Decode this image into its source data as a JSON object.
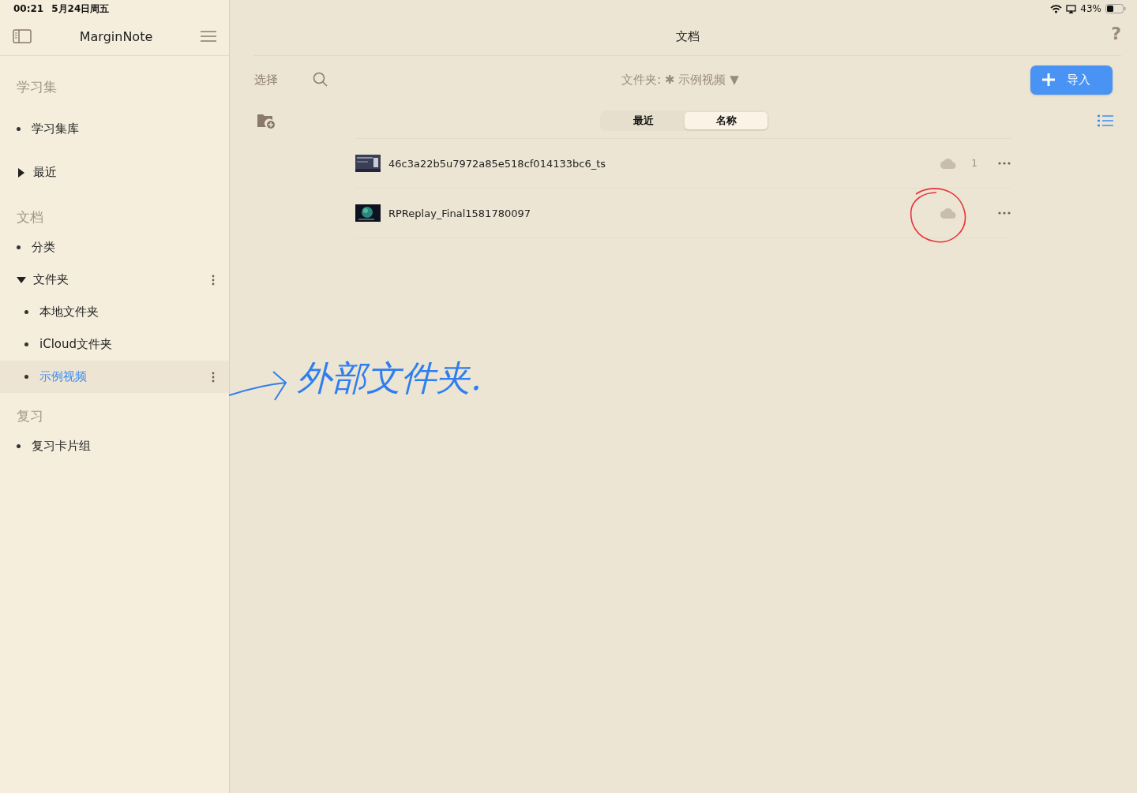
{
  "status_bar": {
    "time": "00:21",
    "date": "5月24日周五",
    "battery": "43%"
  },
  "sidebar": {
    "title": "MarginNote",
    "sections": [
      {
        "header": "学习集",
        "items": [
          {
            "label": "学习集库",
            "kind": "bullet",
            "selected": false
          },
          {
            "label": "最近",
            "kind": "toggle",
            "expanded": false,
            "selected": false
          }
        ]
      },
      {
        "header": "文档",
        "items": [
          {
            "label": "分类",
            "kind": "bullet",
            "selected": false
          },
          {
            "label": "文件夹",
            "kind": "toggle",
            "expanded": true,
            "menu": true,
            "selected": false,
            "children": [
              {
                "label": "本地文件夹",
                "kind": "bullet",
                "selected": false
              },
              {
                "label": "iCloud文件夹",
                "kind": "bullet",
                "selected": false
              },
              {
                "label": "示例视频",
                "kind": "bullet",
                "selected": true,
                "menu": true
              }
            ]
          }
        ]
      },
      {
        "header": "复习",
        "items": [
          {
            "label": "复习卡片组",
            "kind": "bullet",
            "selected": false
          }
        ]
      }
    ]
  },
  "main": {
    "title": "文档",
    "help": "?",
    "select": "选择",
    "folder_label": "文件夹:",
    "folder_mark": "✱",
    "folder_name": "示例视频",
    "folder_caret": "▼",
    "import_button": "导入",
    "sort_tabs": [
      {
        "label": "最近",
        "selected": false
      },
      {
        "label": "名称",
        "selected": true
      }
    ],
    "files": [
      {
        "name": "46c3a22b5u7972a85e518cf014133bc6_ts",
        "count": "1",
        "circled": false
      },
      {
        "name": "RPReplay_Final1581780097",
        "circled": true
      }
    ]
  },
  "annotation": {
    "text": "外部文件夹."
  }
}
